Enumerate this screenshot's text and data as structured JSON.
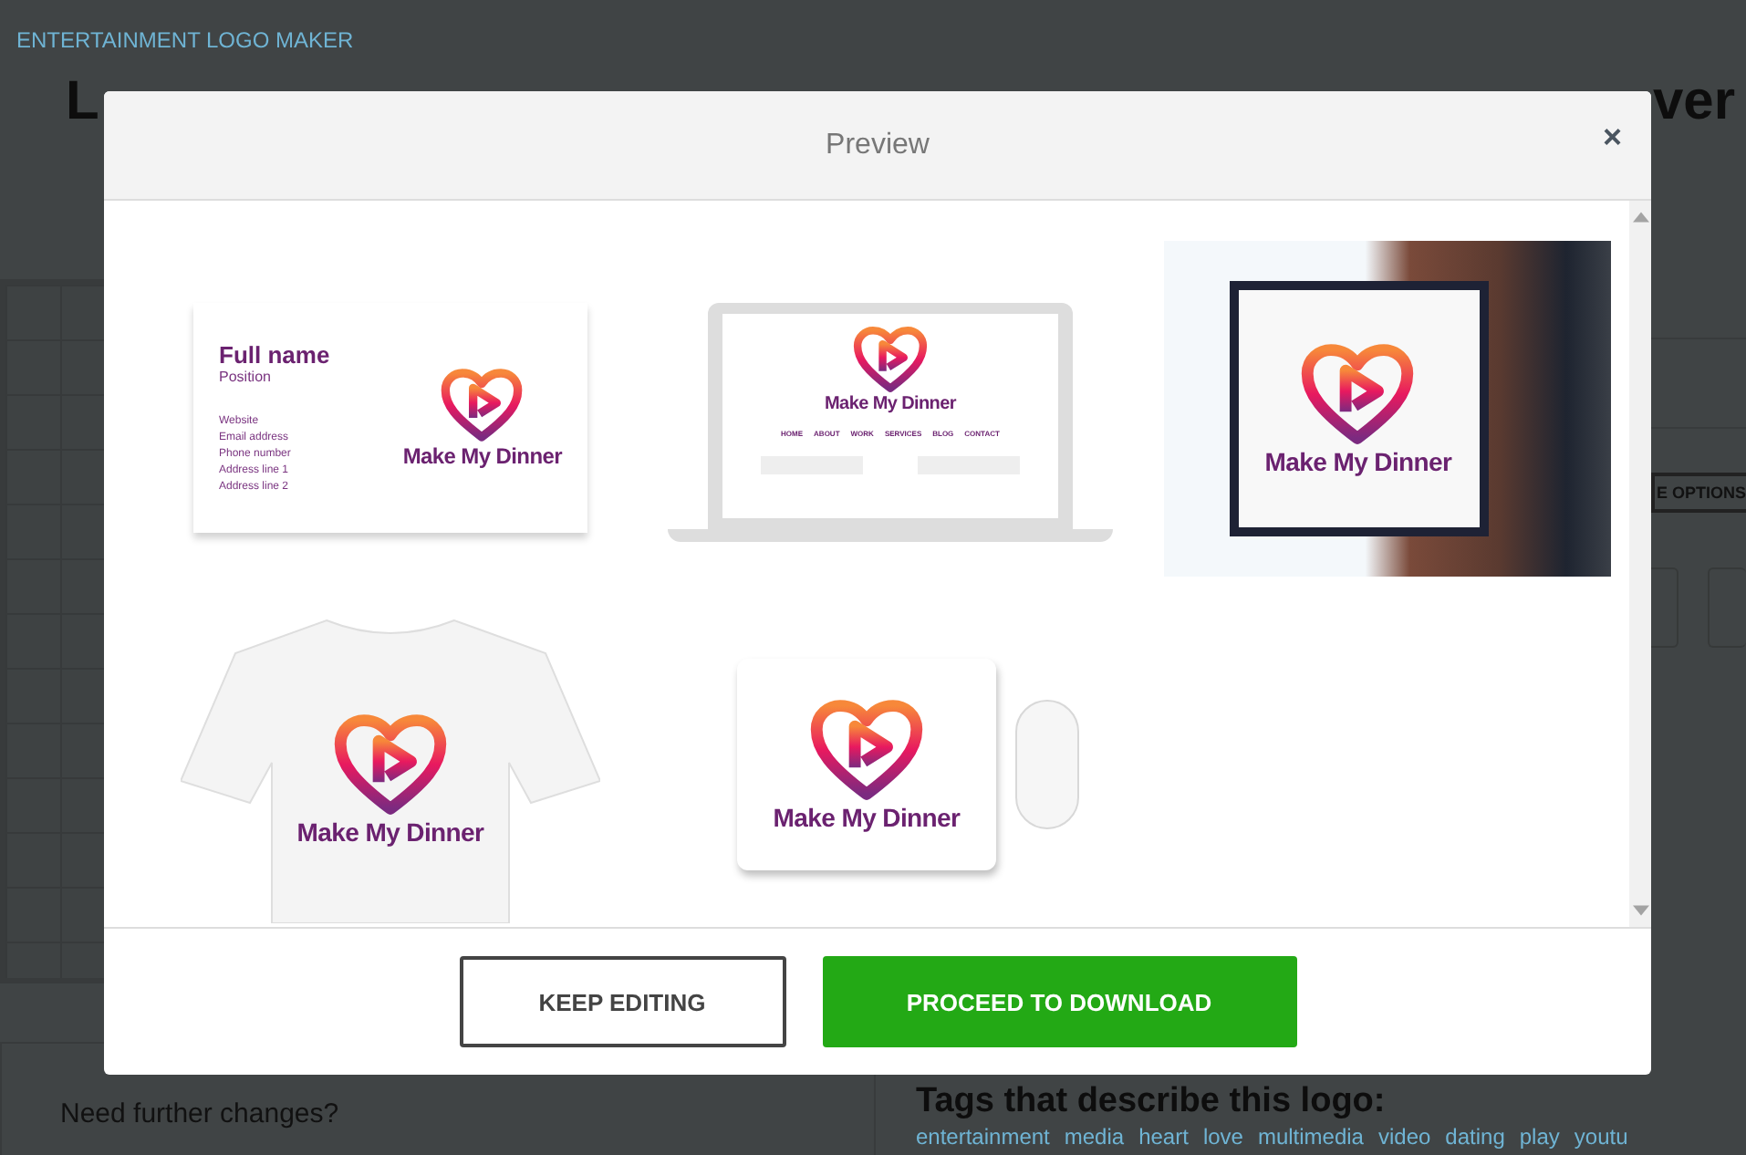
{
  "page": {
    "breadcrumb": "ENTERTAINMENT LOGO MAKER",
    "heading_start": "L",
    "heading_end": "ver",
    "options_button": "E OPTIONS",
    "further_changes": "Need further changes?",
    "tags_heading": "Tags that describe this logo:",
    "tags": [
      "entertainment",
      "media",
      "heart",
      "love",
      "multimedia",
      "video",
      "dating",
      "play",
      "youtu"
    ]
  },
  "modal": {
    "title": "Preview",
    "close": "×",
    "mockups": [
      {
        "kind": "business-card",
        "full_name": "Full name",
        "position": "Position",
        "lines": [
          "Website",
          "Email address",
          "Phone number",
          "Address line 1",
          "Address line 2"
        ],
        "brand": "Make My Dinner"
      },
      {
        "kind": "laptop",
        "brand": "Make My Dinner",
        "nav": [
          "HOME",
          "ABOUT",
          "WORK",
          "SERVICES",
          "BLOG",
          "CONTACT"
        ]
      },
      {
        "kind": "sign",
        "brand": "Make My Dinner"
      },
      {
        "kind": "tshirt",
        "brand": "Make My Dinner"
      },
      {
        "kind": "mousepad",
        "brand": "Make My Dinner"
      }
    ],
    "buttons": [
      {
        "label": "KEEP EDITING",
        "kind": "secondary"
      },
      {
        "label": "PROCEED TO DOWNLOAD",
        "kind": "primary"
      }
    ]
  }
}
